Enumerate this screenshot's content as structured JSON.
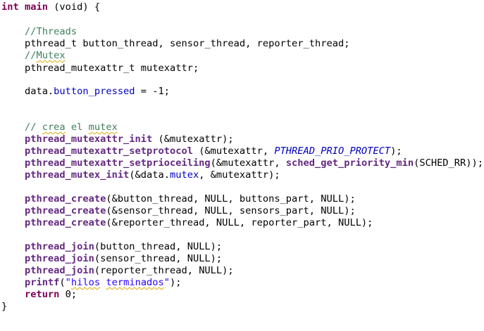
{
  "code": {
    "signature": {
      "kw": "int",
      "name": "main",
      "rest": " (void) {"
    },
    "c_threads": "//Threads",
    "threads_decl": {
      "type": "pthread_t",
      "rest": " button_thread, sensor_thread, reporter_thread;"
    },
    "c_mutex": "//Mutex",
    "mutexattr_decl": {
      "type": "pthread_mutexattr_t",
      "rest": " mutexattr;"
    },
    "assign": {
      "pre": "data.",
      "field": "button_pressed",
      "rest": " = -1;"
    },
    "c_crea": {
      "prefix": "// ",
      "w1": "crea",
      "mid": " el ",
      "w2": "mutex"
    },
    "init_call": {
      "fn": "pthread_mutexattr_init",
      "rest": " (&mutexattr);"
    },
    "setprotocol_call": {
      "fn": "pthread_mutexattr_setprotocol",
      "mid": " (&mutexattr, ",
      "macro": "PTHREAD_PRIO_PROTECT",
      "rest": ");"
    },
    "setprio_call": {
      "fn": "pthread_mutexattr_setprioceiling",
      "mid": "(&mutexattr, ",
      "fn2": "sched_get_priority_min",
      "rest": "(SCHED_RR));"
    },
    "mutex_init_call": {
      "fn": "pthread_mutex_init",
      "pre": "(&data.",
      "field": "mutex",
      "rest": ", &mutexattr);"
    },
    "create_calls": [
      {
        "fn": "pthread_create",
        "rest": "(&button_thread, NULL, buttons_part, NULL);"
      },
      {
        "fn": "pthread_create",
        "rest": "(&sensor_thread, NULL, sensors_part, NULL);"
      },
      {
        "fn": "pthread_create",
        "rest": "(&reporter_thread, NULL, reporter_part, NULL);"
      }
    ],
    "join_calls": [
      {
        "fn": "pthread_join",
        "rest": "(button_thread, NULL);"
      },
      {
        "fn": "pthread_join",
        "rest": "(sensor_thread, NULL);"
      },
      {
        "fn": "pthread_join",
        "rest": "(reporter_thread, NULL);"
      }
    ],
    "printf_call": {
      "fn": "printf",
      "open": "(",
      "q1": "\"",
      "w1": "hilos",
      "sp": " ",
      "w2": "terminados",
      "q2": "\"",
      "rest": ");"
    },
    "return_stmt": {
      "kw": "return",
      "rest": " 0;"
    },
    "close_brace": "}"
  },
  "colors": {
    "keyword": "#7f0055",
    "function": "#642880",
    "comment": "#3f7f5f",
    "field": "#0000c0",
    "string": "#2a00ff",
    "spell_squiggle": "#d8a800"
  }
}
